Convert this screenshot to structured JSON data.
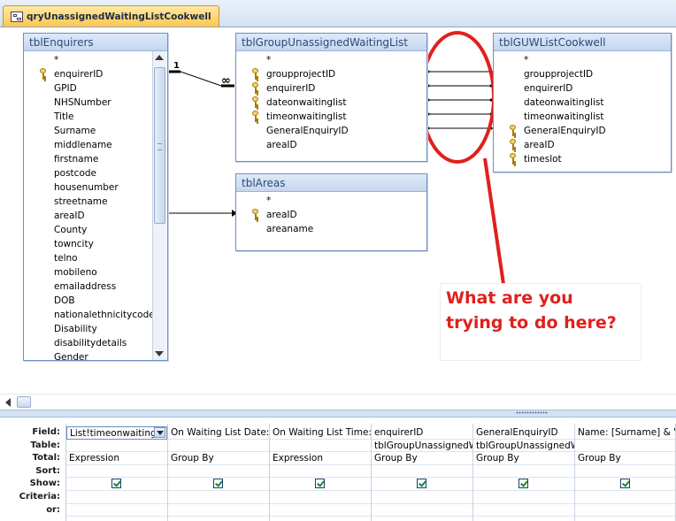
{
  "tab": {
    "title": "qryUnassignedWaitingListCookwell"
  },
  "tables": {
    "enquirers": {
      "title": "tblEnquirers",
      "fields": [
        {
          "name": "*",
          "key": false
        },
        {
          "name": "enquirerID",
          "key": true
        },
        {
          "name": "GPID",
          "key": false
        },
        {
          "name": "NHSNumber",
          "key": false
        },
        {
          "name": "Title",
          "key": false
        },
        {
          "name": "Surname",
          "key": false
        },
        {
          "name": "middlename",
          "key": false
        },
        {
          "name": "firstname",
          "key": false
        },
        {
          "name": "postcode",
          "key": false
        },
        {
          "name": "housenumber",
          "key": false
        },
        {
          "name": "streetname",
          "key": false
        },
        {
          "name": "areaID",
          "key": false
        },
        {
          "name": "County",
          "key": false
        },
        {
          "name": "towncity",
          "key": false
        },
        {
          "name": "telno",
          "key": false
        },
        {
          "name": "mobileno",
          "key": false
        },
        {
          "name": "emailaddress",
          "key": false
        },
        {
          "name": "DOB",
          "key": false
        },
        {
          "name": "nationalethnicitycode",
          "key": false
        },
        {
          "name": "Disability",
          "key": false
        },
        {
          "name": "disabilitydetails",
          "key": false
        },
        {
          "name": "Gender",
          "key": false
        }
      ]
    },
    "group_unassigned": {
      "title": "tblGroupUnassignedWaitingList",
      "fields": [
        {
          "name": "*",
          "key": false
        },
        {
          "name": "groupprojectID",
          "key": true
        },
        {
          "name": "enquirerID",
          "key": true
        },
        {
          "name": "dateonwaitinglist",
          "key": true
        },
        {
          "name": "timeonwaitinglist",
          "key": true
        },
        {
          "name": "GeneralEnquiryID",
          "key": false
        },
        {
          "name": "areaID",
          "key": false
        }
      ]
    },
    "areas": {
      "title": "tblAreas",
      "fields": [
        {
          "name": "*",
          "key": false
        },
        {
          "name": "areaID",
          "key": true
        },
        {
          "name": "areaname",
          "key": false
        }
      ]
    },
    "guw_cookwell": {
      "title": "tblGUWListCookwell",
      "fields": [
        {
          "name": "*",
          "key": false
        },
        {
          "name": "groupprojectID",
          "key": false
        },
        {
          "name": "enquirerID",
          "key": false
        },
        {
          "name": "dateonwaitinglist",
          "key": false
        },
        {
          "name": "timeonwaitinglist",
          "key": false
        },
        {
          "name": "GeneralEnquiryID",
          "key": true
        },
        {
          "name": "areaID",
          "key": true
        },
        {
          "name": "timeslot",
          "key": true
        }
      ]
    }
  },
  "relationships": {
    "one_label": "1",
    "many_label": "∞"
  },
  "annotation": {
    "text": "What are you trying to do here?",
    "color": "#e0201c"
  },
  "grid": {
    "row_labels": [
      "Field:",
      "Table:",
      "Total:",
      "Sort:",
      "Show:",
      "Criteria:",
      "or:"
    ],
    "columns": [
      {
        "field": "List!timeonwaiting",
        "table": "",
        "total": "Expression",
        "show": true
      },
      {
        "field": "On Waiting List Date:",
        "table": "",
        "total": "Group By",
        "show": true
      },
      {
        "field": "On Waiting List Time:",
        "table": "",
        "total": "Expression",
        "show": true
      },
      {
        "field": "enquirerID",
        "table": "tblGroupUnassignedW",
        "total": "Group By",
        "show": true
      },
      {
        "field": "GeneralEnquiryID",
        "table": "tblGroupUnassignedW",
        "total": "Group By",
        "show": true
      },
      {
        "field": "Name: [Surname] & \",",
        "table": "",
        "total": "Group By",
        "show": true
      }
    ]
  }
}
